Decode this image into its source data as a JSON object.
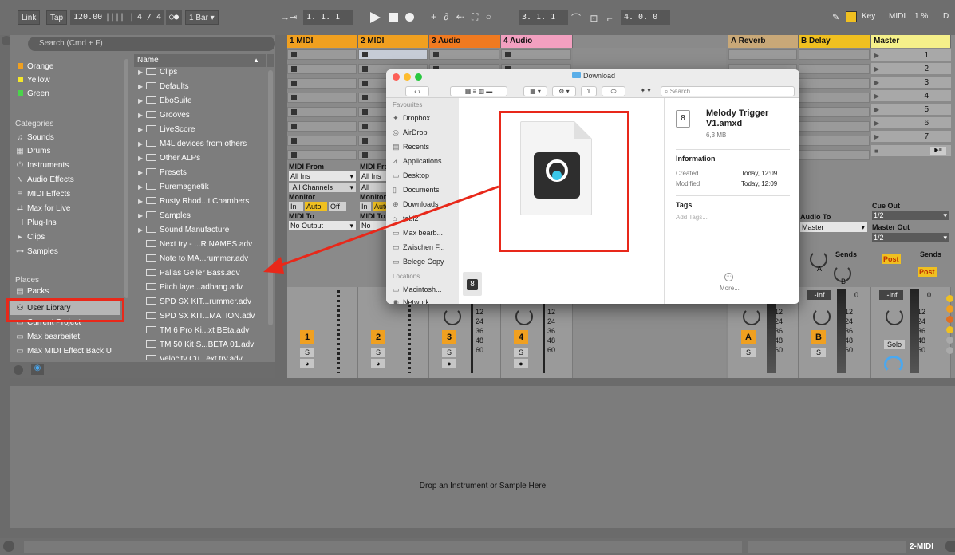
{
  "transport": {
    "link": "Link",
    "tap": "Tap",
    "tempo": "120.00",
    "tempo_bars": "||||  ||||",
    "signature": "4 / 4",
    "metro": "○●",
    "quantize": "1 Bar",
    "position": "1.  1.  1",
    "loop_start": "3.  1.  1",
    "loop_length": "4.  0.  0",
    "key": "Key",
    "midi": "MIDI",
    "cpu": "1 %",
    "d": "D"
  },
  "browser": {
    "search_placeholder": "Search (Cmd + F)",
    "colors": [
      {
        "label": "Orange",
        "color": "#f0a020"
      },
      {
        "label": "Yellow",
        "color": "#f5e82a"
      },
      {
        "label": "Green",
        "color": "#4bd44b"
      }
    ],
    "categories_title": "Categories",
    "categories": [
      {
        "label": "Sounds",
        "icon": "♫"
      },
      {
        "label": "Drums",
        "icon": "▦"
      },
      {
        "label": "Instruments",
        "icon": "⏻"
      },
      {
        "label": "Audio Effects",
        "icon": "∿"
      },
      {
        "label": "MIDI Effects",
        "icon": "≡"
      },
      {
        "label": "Max for Live",
        "icon": "⇄"
      },
      {
        "label": "Plug-Ins",
        "icon": "⊣"
      },
      {
        "label": "Clips",
        "icon": "▸"
      },
      {
        "label": "Samples",
        "icon": "⊶"
      }
    ],
    "places_title": "Places",
    "places": [
      {
        "label": "Packs",
        "icon": "▤"
      },
      {
        "label": "User Library",
        "icon": "⚇"
      },
      {
        "label": "Current Project",
        "icon": "▭"
      },
      {
        "label": "Max bearbeitet",
        "icon": "▭"
      },
      {
        "label": "Max MIDI Effect Back U",
        "icon": "▭"
      }
    ],
    "name_header": "Name",
    "folders": [
      "Clips",
      "Defaults",
      "EboSuite",
      "Grooves",
      "LiveScore",
      "M4L devices from others",
      "Other ALPs",
      "Presets",
      "Puremagnetik",
      "Rusty Rhod...t Chambers",
      "Samples",
      "Sound Manufacture"
    ],
    "files": [
      "Next try - ...R NAMES.adv",
      "Note to MA...rummer.adv",
      "Pallas  Geiler Bass.adv",
      "Pitch laye...adbang.adv",
      "SPD SX KIT...rummer.adv",
      "SPD SX KIT...MATION.adv",
      "TM 6 Pro Ki...xt BEta.adv",
      "TM 50 Kit S...BETA 01.adv",
      "Velocity Cu...ext try.adv"
    ]
  },
  "tracks": [
    {
      "name": "1 MIDI",
      "color": "#f0a020",
      "num": "1"
    },
    {
      "name": "2 MIDI",
      "color": "#f0a020",
      "num": "2"
    },
    {
      "name": "3 Audio",
      "color": "#f07a20",
      "num": "3"
    },
    {
      "name": "4 Audio",
      "color": "#f2a0c0",
      "num": "4"
    },
    {
      "name": "A Reverb",
      "color": "#c8a878",
      "num": "A"
    },
    {
      "name": "B Delay",
      "color": "#f0c020",
      "num": "B"
    },
    {
      "name": "Master",
      "color": "#f5f08a",
      "num": ""
    }
  ],
  "io": {
    "midi_from": "MIDI From",
    "all_ins": "All Ins",
    "all_channels": "All Channels",
    "monitor": "Monitor",
    "mon_in": "In",
    "mon_auto": "Auto",
    "mon_off": "Off",
    "midi_to": "MIDI To",
    "no_output": "No Output",
    "audio_to": "Audio To",
    "master": "Master",
    "cue_out": "Cue Out",
    "cue_val": "1/2",
    "master_out": "Master Out",
    "master_val": "1/2",
    "sends": "Sends",
    "post": "Post",
    "knob_a": "A",
    "knob_b": "B",
    "inf": "-Inf",
    "zero": "0",
    "solo": "Solo",
    "s": "S",
    "scale": [
      "12",
      "24",
      "36",
      "48",
      "60"
    ]
  },
  "master_scenes": [
    "1",
    "2",
    "3",
    "4",
    "5",
    "6",
    "7"
  ],
  "drop_text": "Drop an Instrument or Sample Here",
  "status_track": "2-MIDI",
  "finder": {
    "title": "Download",
    "search": "Search",
    "favourites": "Favourites",
    "fav_items": [
      {
        "label": "Dropbox",
        "icon": "✦"
      },
      {
        "label": "AirDrop",
        "icon": "◎"
      },
      {
        "label": "Recents",
        "icon": "▤"
      },
      {
        "label": "Applications",
        "icon": "⩘"
      },
      {
        "label": "Desktop",
        "icon": "▭"
      },
      {
        "label": "Documents",
        "icon": "▯"
      },
      {
        "label": "Downloads",
        "icon": "⊕"
      },
      {
        "label": "tobi2",
        "icon": "⌂"
      },
      {
        "label": "Max bearb...",
        "icon": "▭"
      },
      {
        "label": "Zwischen F...",
        "icon": "▭"
      },
      {
        "label": "Belege Copy",
        "icon": "▭"
      }
    ],
    "locations": "Locations",
    "loc_items": [
      {
        "label": "Macintosh...",
        "icon": "▭"
      },
      {
        "label": "Network",
        "icon": "◉"
      }
    ],
    "file_name": "Melody Trigger V1.amxd",
    "file_size": "6,3 MB",
    "information": "Information",
    "created_label": "Created",
    "created_val": "Today, 12:09",
    "modified_label": "Modified",
    "modified_val": "Today, 12:09",
    "tags": "Tags",
    "add_tags": "Add Tags...",
    "more": "More..."
  }
}
